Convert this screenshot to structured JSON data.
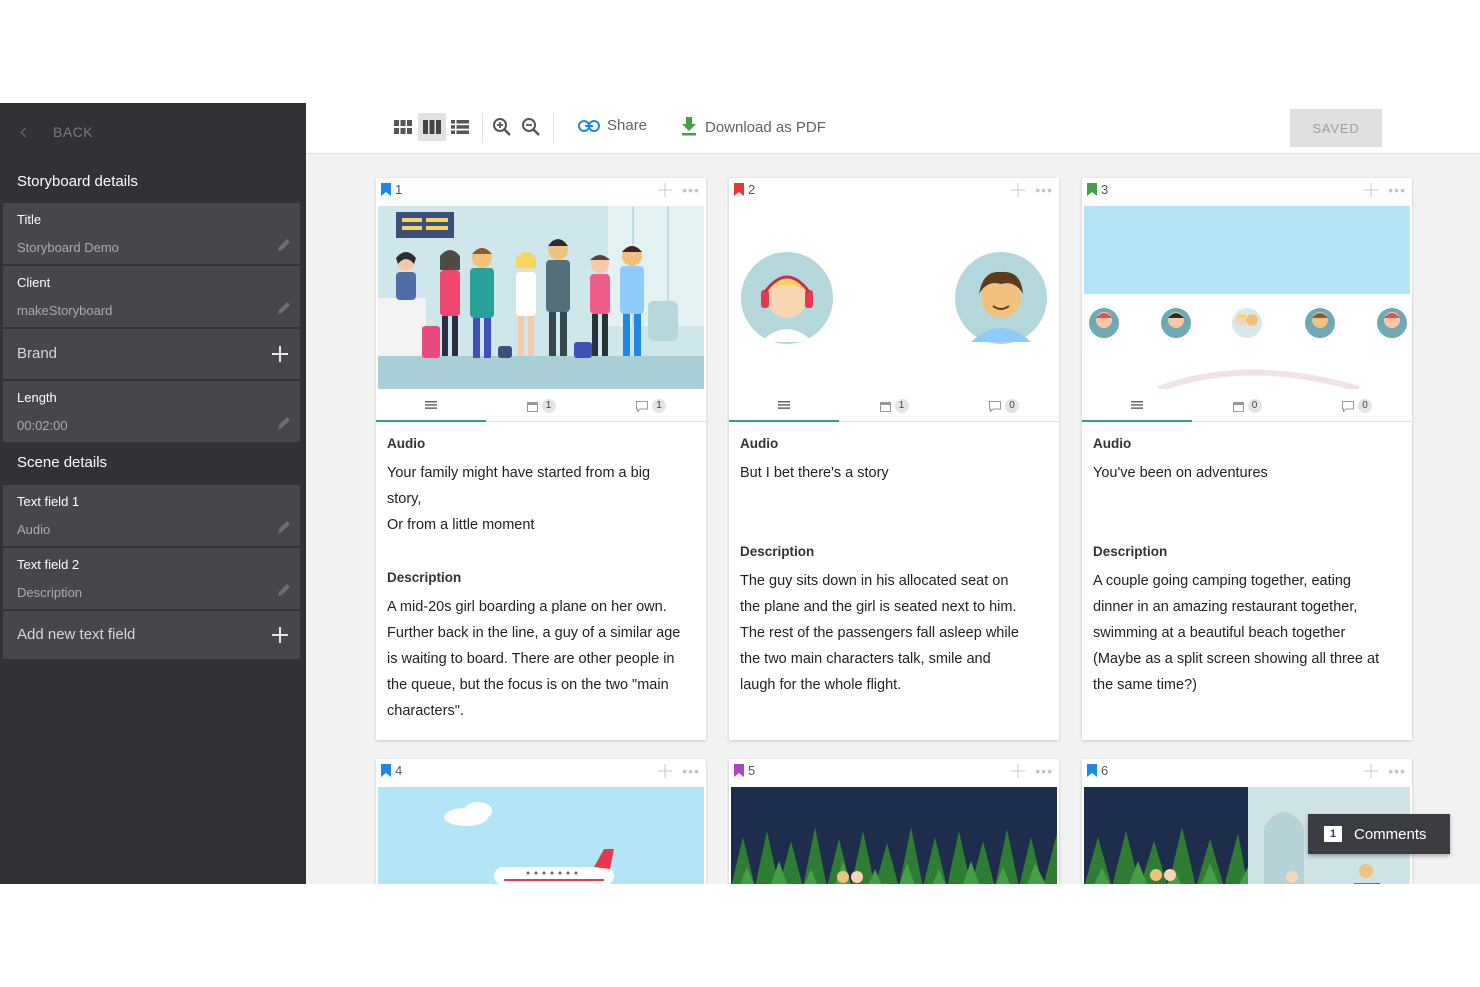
{
  "sidebar": {
    "back_label": "BACK",
    "storyboard_section": "Storyboard details",
    "fields": [
      {
        "label": "Title",
        "value": "Storyboard Demo"
      },
      {
        "label": "Client",
        "value": "makeStoryboard"
      },
      {
        "label": "Brand"
      },
      {
        "label": "Length",
        "value": "00:02:00"
      }
    ],
    "scene_section": "Scene details",
    "scene_fields": [
      {
        "label": "Text field 1",
        "value": "Audio"
      },
      {
        "label": "Text field 2",
        "value": "Description"
      }
    ],
    "add_field_label": "Add new text field"
  },
  "toolbar": {
    "share_label": "Share",
    "download_label": "Download as PDF",
    "saved_label": "SAVED",
    "view_modes": [
      "grid-small-icon",
      "grid-columns-icon",
      "list-icon"
    ],
    "active_view": "grid-columns-icon"
  },
  "cards": [
    {
      "number": "1",
      "bookmark_color": "#1e88e5",
      "date_count": "1",
      "comment_count": "1",
      "audio_heading": "Audio",
      "audio_lines": [
        "Your family might have started from a big",
        "story,",
        "Or from a little moment"
      ],
      "description_heading": "Description",
      "description_lines": [
        "A mid-20s girl boarding a plane on her own.",
        "Further back in the line, a guy of a similar age",
        "is waiting to board. There are other people in",
        "the queue, but the focus is on the two \"main",
        "characters\"."
      ]
    },
    {
      "number": "2",
      "bookmark_color": "#e53935",
      "date_count": "1",
      "comment_count": "0",
      "audio_heading": "Audio",
      "audio_lines": [
        "But I bet there's a story"
      ],
      "description_heading": "Description",
      "description_lines": [
        "The guy sits down in his allocated seat on",
        "the plane and the girl is seated next to him.",
        "The rest of the passengers fall asleep while",
        "the two main characters talk, smile and",
        "laugh for the whole flight."
      ]
    },
    {
      "number": "3",
      "bookmark_color": "#43a047",
      "date_count": "0",
      "comment_count": "0",
      "audio_heading": "Audio",
      "audio_lines": [
        "You've been on adventures"
      ],
      "description_heading": "Description",
      "description_lines": [
        "A couple going camping together, eating",
        "dinner in an amazing restaurant together,",
        "swimming at a beautiful beach together",
        "(Maybe as a split screen showing all three at",
        "the same time?)"
      ]
    },
    {
      "number": "4",
      "bookmark_color": "#1e88e5"
    },
    {
      "number": "5",
      "bookmark_color": "#ab47bc"
    },
    {
      "number": "6",
      "bookmark_color": "#1e88e5"
    }
  ],
  "comments_button": {
    "label": "Comments",
    "count": "1"
  }
}
